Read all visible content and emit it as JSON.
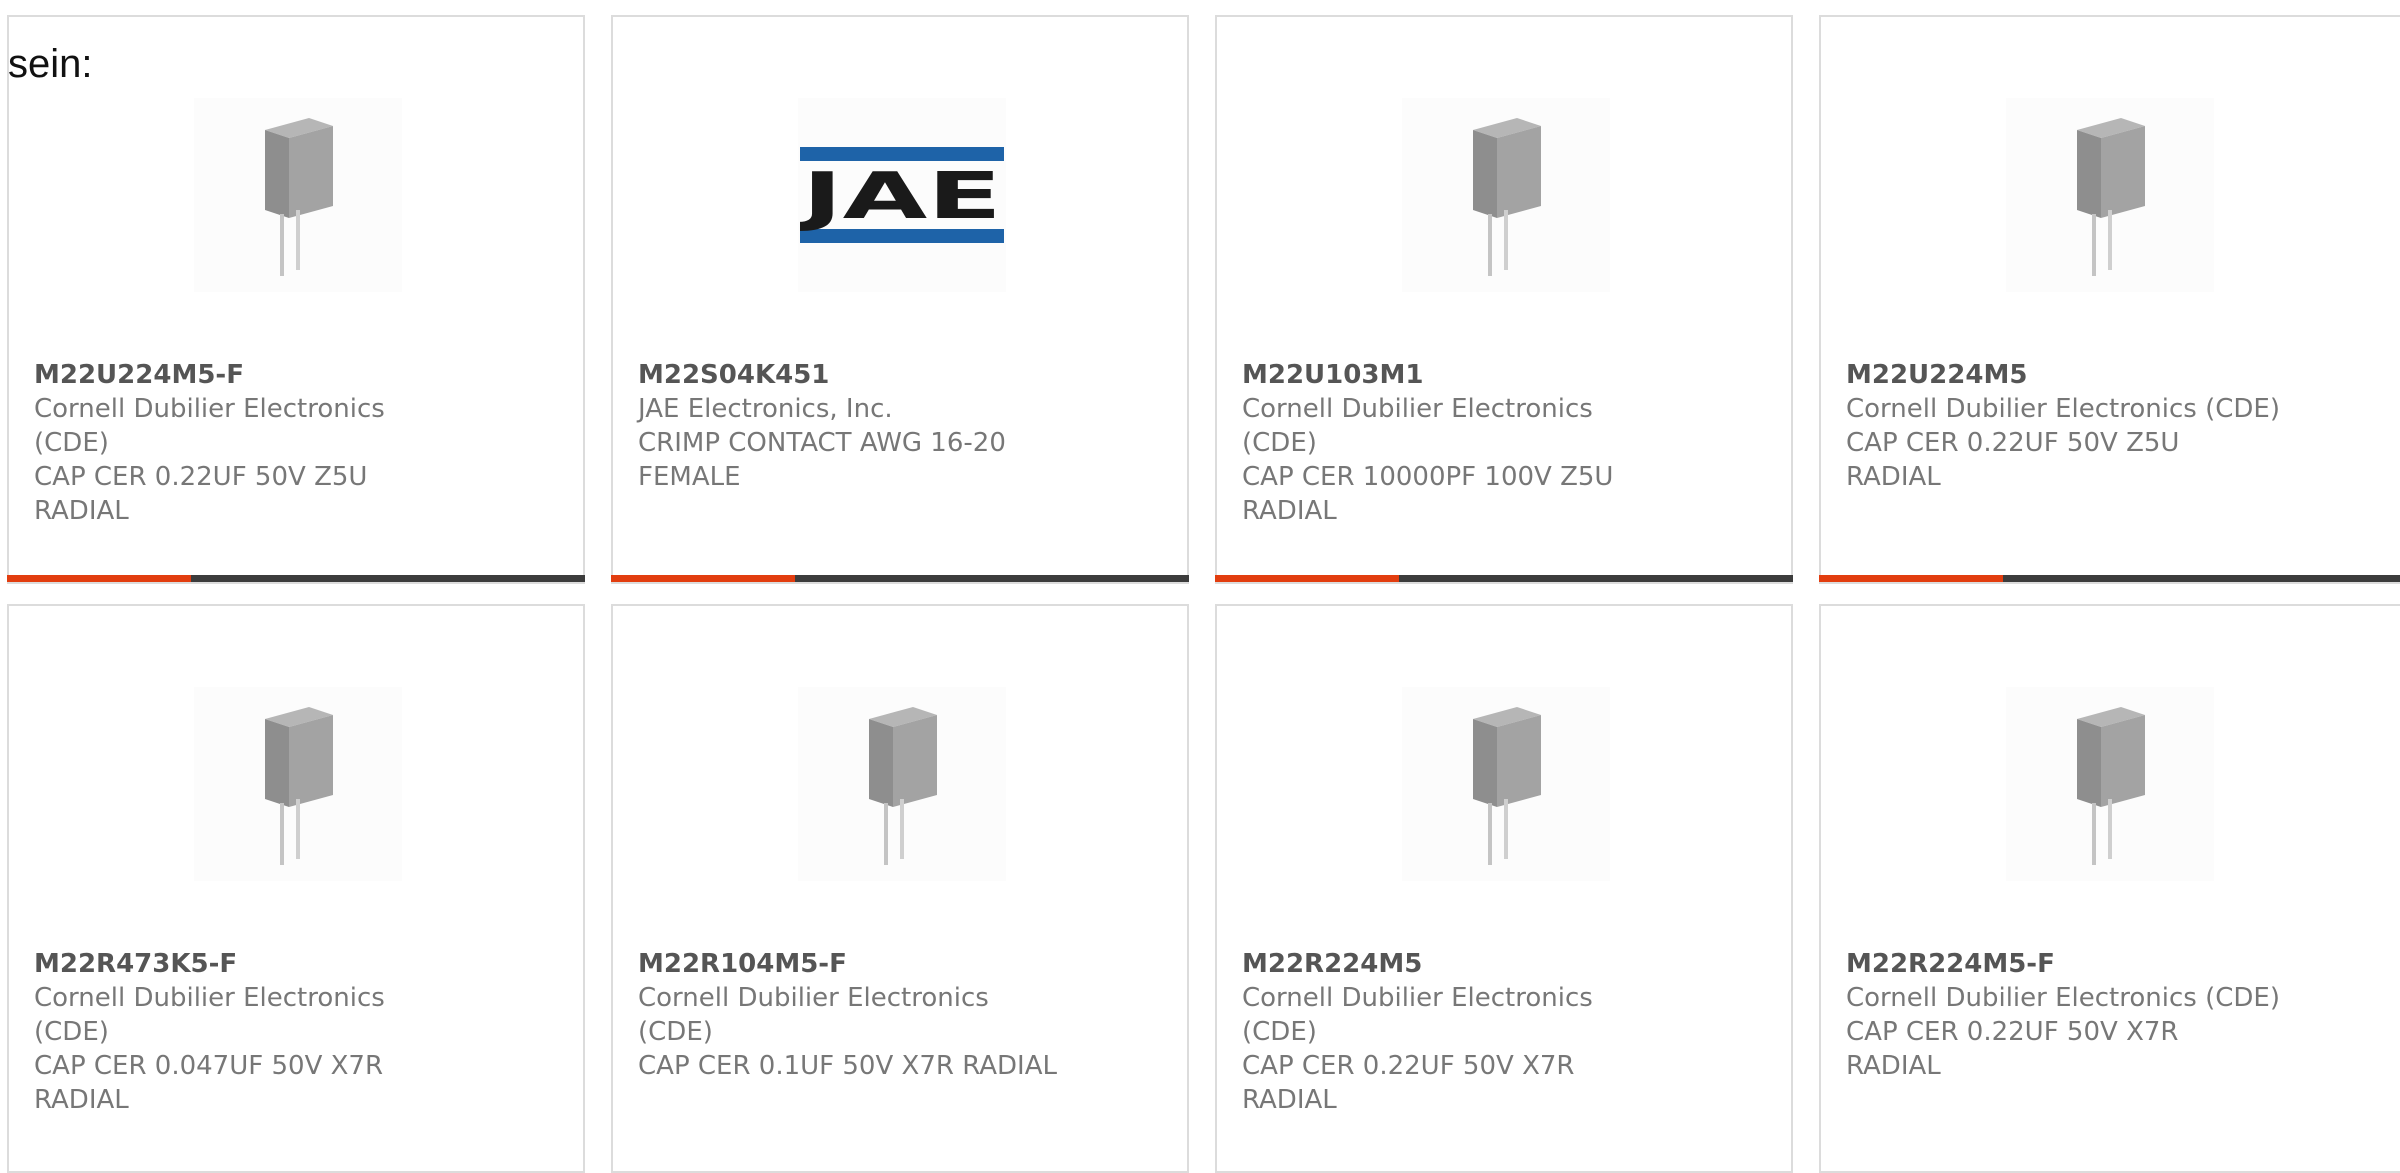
{
  "intro_text": "sein:",
  "accent_color": "#e23d0f",
  "bar_color": "#3c3c3c",
  "products": [
    {
      "part_number": "M22U224M5-F",
      "manufacturer": "Cornell Dubilier Electronics (CDE)",
      "description": "CAP CER 0.22UF 50V Z5U RADIAL",
      "image": "capacitor-icon"
    },
    {
      "part_number": "M22S04K451",
      "manufacturer": "JAE Electronics, Inc.",
      "description": "CRIMP CONTACT AWG 16-20 FEMALE",
      "image": "jae-logo",
      "logo_text": "JAE"
    },
    {
      "part_number": "M22U103M1",
      "manufacturer": "Cornell Dubilier Electronics (CDE)",
      "description": "CAP CER 10000PF 100V Z5U RADIAL",
      "image": "capacitor-icon"
    },
    {
      "part_number": "M22U224M5",
      "manufacturer": "Cornell Dubilier Electronics (CDE)",
      "description": "CAP CER 0.22UF 50V Z5U RADIAL",
      "image": "capacitor-icon"
    },
    {
      "part_number": "M22R473K5-F",
      "manufacturer": "Cornell Dubilier Electronics (CDE)",
      "description": "CAP CER 0.047UF 50V X7R RADIAL",
      "image": "capacitor-icon"
    },
    {
      "part_number": "M22R104M5-F",
      "manufacturer": "Cornell Dubilier Electronics (CDE)",
      "description": "CAP CER 0.1UF 50V X7R RADIAL",
      "image": "capacitor-icon"
    },
    {
      "part_number": "M22R224M5",
      "manufacturer": "Cornell Dubilier Electronics (CDE)",
      "description": "CAP CER 0.22UF 50V X7R RADIAL",
      "image": "capacitor-icon"
    },
    {
      "part_number": "M22R224M5-F",
      "manufacturer": "Cornell Dubilier Electronics (CDE)",
      "description": "CAP CER 0.22UF 50V X7R RADIAL",
      "image": "capacitor-icon"
    }
  ]
}
